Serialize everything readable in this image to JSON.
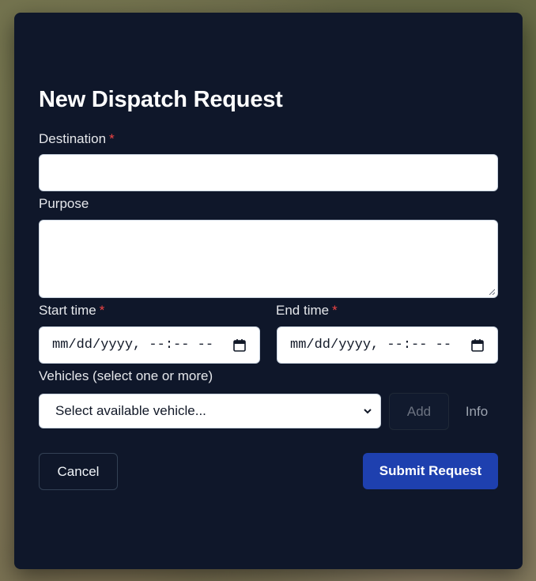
{
  "dialog": {
    "title": "New Dispatch Request"
  },
  "form": {
    "destination": {
      "label": "Destination",
      "required_mark": "*",
      "value": ""
    },
    "purpose": {
      "label": "Purpose",
      "value": ""
    },
    "start_time": {
      "label": "Start time",
      "required_mark": "*",
      "placeholder": "mm/dd/yyyy, --:-- --"
    },
    "end_time": {
      "label": "End time",
      "required_mark": "*",
      "placeholder": "mm/dd/yyyy, --:-- --"
    },
    "vehicles": {
      "label": "Vehicles (select one or more)",
      "selected": "Select available vehicle...",
      "add_label": "Add",
      "info_label": "Info"
    }
  },
  "actions": {
    "cancel_label": "Cancel",
    "submit_label": "Submit Request"
  },
  "colors": {
    "modal_bg": "#0f172a",
    "primary": "#1e40af",
    "required": "#ef4444"
  },
  "icons": {
    "date": "calendar-icon",
    "select": "chevron-down-icon"
  }
}
